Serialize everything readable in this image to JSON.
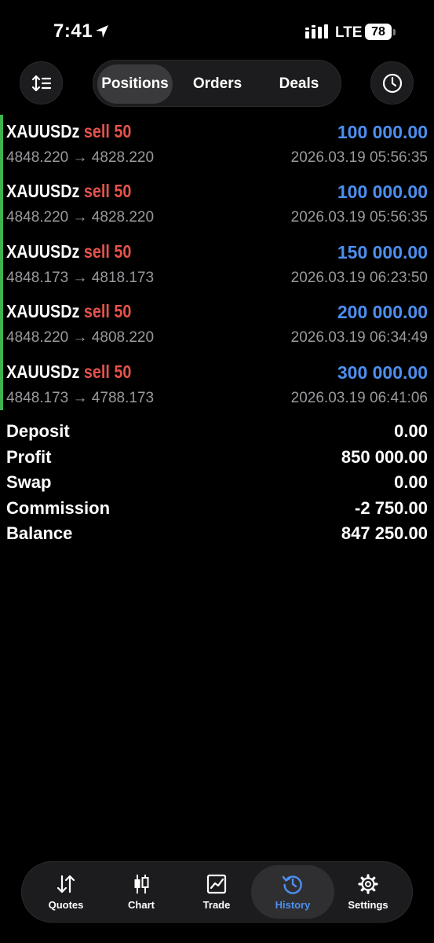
{
  "status_bar": {
    "time": "7:41",
    "network": "LTE",
    "battery": "78"
  },
  "segments": [
    "Positions",
    "Orders",
    "Deals"
  ],
  "active_segment": "Positions",
  "deals": [
    {
      "symbol": "XAUUSDz",
      "side": "sell 50",
      "prices": "4848.220 → 4828.220",
      "profit": "100 000.00",
      "time": "2026.03.19 05:56:35"
    },
    {
      "symbol": "XAUUSDz",
      "side": "sell 50",
      "prices": "4848.220 → 4828.220",
      "profit": "100 000.00",
      "time": "2026.03.19 05:56:35"
    },
    {
      "symbol": "XAUUSDz",
      "side": "sell 50",
      "prices": "4848.173 → 4818.173",
      "profit": "150 000.00",
      "time": "2026.03.19 06:23:50"
    },
    {
      "symbol": "XAUUSDz",
      "side": "sell 50",
      "prices": "4848.220 → 4808.220",
      "profit": "200 000.00",
      "time": "2026.03.19 06:34:49"
    },
    {
      "symbol": "XAUUSDz",
      "side": "sell 50",
      "prices": "4848.173 → 4788.173",
      "profit": "300 000.00",
      "time": "2026.03.19 06:41:06"
    }
  ],
  "summary": [
    {
      "label": "Deposit",
      "value": "0.00"
    },
    {
      "label": "Profit",
      "value": "850 000.00"
    },
    {
      "label": "Swap",
      "value": "0.00"
    },
    {
      "label": "Commission",
      "value": "-2 750.00"
    },
    {
      "label": "Balance",
      "value": "847 250.00"
    }
  ],
  "tabs": [
    {
      "label": "Quotes",
      "icon": "quotes-icon"
    },
    {
      "label": "Chart",
      "icon": "chart-icon"
    },
    {
      "label": "Trade",
      "icon": "trade-icon"
    },
    {
      "label": "History",
      "icon": "history-icon"
    },
    {
      "label": "Settings",
      "icon": "settings-icon"
    }
  ],
  "active_tab": "History",
  "colors": {
    "accent": "#4d8ff0",
    "sell": "#e5534b",
    "bar": "#3fb34f",
    "muted": "#9a9a9e"
  }
}
